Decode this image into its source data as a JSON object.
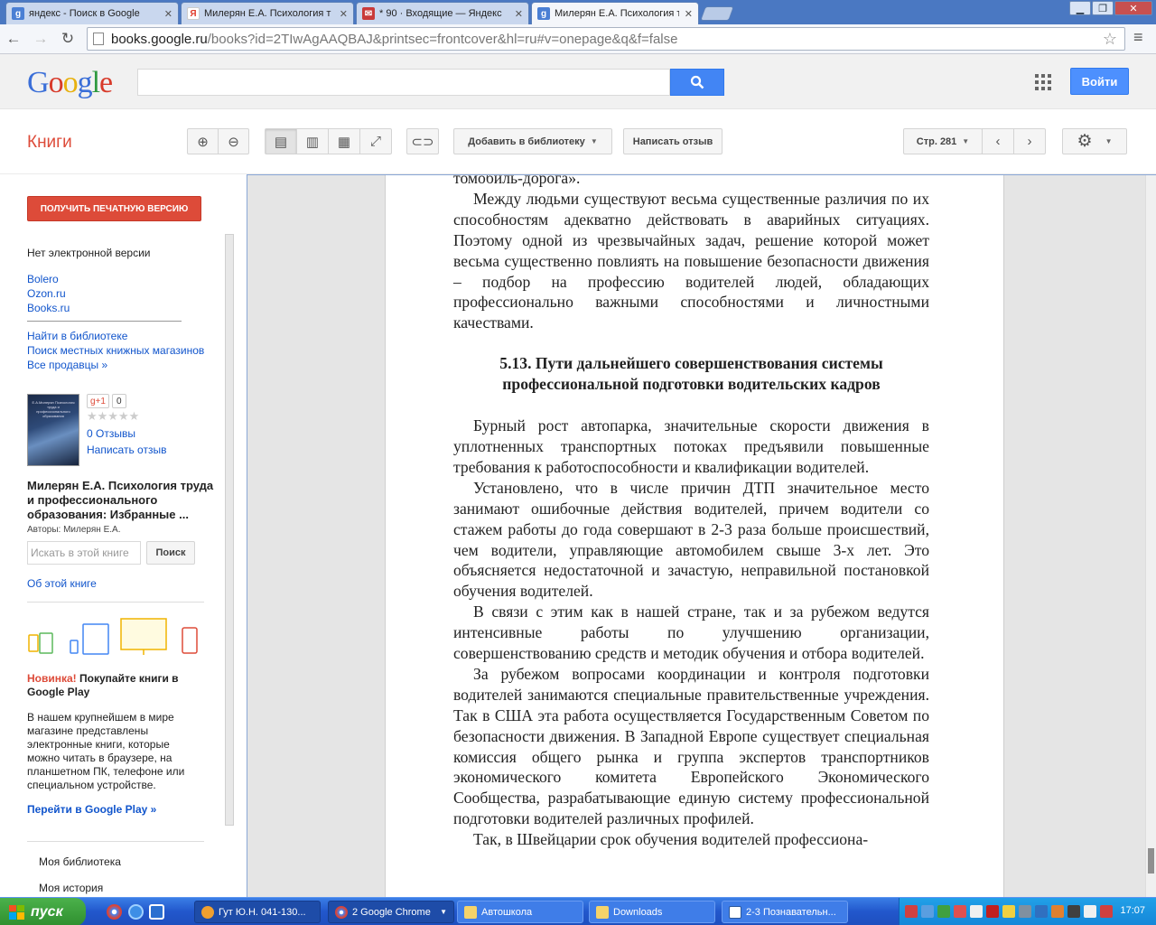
{
  "tabs": [
    {
      "title": "яндекс - Поиск в Google",
      "favicon": "google-g-icon",
      "color": "#4a7fd4"
    },
    {
      "title": "Милерян Е.А. Психология т",
      "favicon": "yandex-y-icon",
      "color": "#e03b2b"
    },
    {
      "title": "* 90 · Входящие — Яндекс",
      "favicon": "yandex-mail-icon",
      "color": "#c93a3a"
    },
    {
      "title": "Милерян Е.А. Психология т",
      "favicon": "google-g-icon",
      "color": "#4a7fd4"
    }
  ],
  "address": {
    "host": "books.google.ru",
    "path": "/books?id=2TIwAgAAQBAJ&printsec=frontcover&hl=ru#v=onepage&q&f=false"
  },
  "google": {
    "signin": "Войти",
    "logo_letters": [
      "G",
      "o",
      "o",
      "g",
      "l",
      "e"
    ],
    "logo_colors": [
      "#3b6fd8",
      "#d83b2b",
      "#e8b10f",
      "#3b6fd8",
      "#2f9a3f",
      "#d83b2b"
    ]
  },
  "books": {
    "title": "Книги",
    "add_library": "Добавить в библиотеку",
    "write_review": "Написать отзыв",
    "page_label": "Стр. 281"
  },
  "sidebar": {
    "get_print": "ПОЛУЧИТЬ ПЕЧАТНУЮ ВЕРСИЮ",
    "no_ebook": "Нет электронной версии",
    "sellers": [
      "Bolero",
      "Ozon.ru",
      "Books.ru"
    ],
    "find_library": "Найти в библиотеке",
    "local_stores": "Поиск местных книжных магазинов",
    "all_sellers": "Все продавцы »",
    "gplus": "g+1",
    "gplus_count": "0",
    "stars": "★★★★★",
    "reviews": "0 Отзывы",
    "write_review": "Написать отзыв",
    "cover_text": "Е.А.Милерян Психология труда и профессионального образования",
    "book_title": "Милерян Е.А. Психология труда и профессионального образования: Избранные ...",
    "authors": "Авторы: Милерян Е.А.",
    "search_placeholder": "Искать в этой книге",
    "search_button": "Поиск",
    "about": "Об этой книге",
    "promo_new": "Новинка!",
    "promo_title": " Покупайте книги в Google Play",
    "promo_body": "В нашем крупнейшем в мире магазине представлены электронные книги, которые можно читать в браузере, на планшетном ПК, телефоне или специальном устройстве.",
    "promo_link": "Перейти в Google Play »",
    "my_library": "Моя библиотека",
    "my_history": "Моя история"
  },
  "page": {
    "p0": "томобиль-дорога».",
    "p1": "Между людьми существуют весьма существенные различия по их способностям адекватно действовать в аварийных ситуациях. Поэтому одной из чрезвычайных задач, решение которой может весьма существенно повлиять на повышение безопасности движения – подбор на профессию водителей людей, обладающих профессионально важными способностями и личностными качествами.",
    "heading": "5.13. Пути дальнейшего совершенствования системы профессиональной подготовки водительских кадров",
    "p2": "Бурный рост автопарка, значительные скорости движения в уплотненных транспортных потоках предъявили повышенные требования к работоспособности и квалификации водителей.",
    "p3": "Установлено, что в числе причин ДТП значительное место занимают ошибочные действия водителей, причем водители со стажем работы до года совершают в 2-3 раза больше происшествий, чем водители, управляющие автомобилем свыше 3-х лет. Это объясняется недостаточной и зачастую, неправильной постановкой обучения водителей.",
    "p4": "В связи с этим как в нашей стране, так и за рубежом ведутся интенсивные работы по улучшению организации, совершенствованию средств и методик обучения и отбора водителей.",
    "p5": "За рубежом вопросами координации и контроля подготовки водителей занимаются специальные правительственные учреждения. Так в США эта работа осуществляется Государственным Советом по безопасности движения. В Западной Европе существует специальная комиссия общего рынка и группа экспертов транспортников экономического комитета Европейского Экономического Сообщества, разрабатывающие единую систему профессиональной подготовки водителей различных профилей.",
    "p6": "Так, в Швейцарии срок обучения водителей профессиона-"
  },
  "taskbar": {
    "start": "пуск",
    "tasks": [
      "Гут Ю.Н. 041-130...",
      "2 Google Chrome",
      "Автошкола",
      "Downloads",
      "2-3 Познавательн..."
    ],
    "clock": "17:07"
  }
}
